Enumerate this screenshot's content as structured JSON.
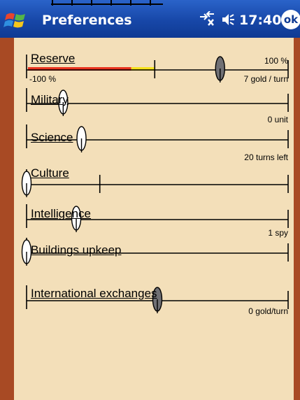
{
  "titlebar": {
    "title": "Preferences",
    "time": "17:40",
    "ok_label": "ok",
    "icons": [
      "windows-start-icon",
      "connectivity-icon",
      "volume-icon",
      "ok-icon"
    ]
  },
  "sliders": [
    {
      "label": "Reserve",
      "value_text": "100 %",
      "min_text": "-100 %",
      "secondary_text": "7 gold / turn",
      "knob_level": 0.74,
      "knob_style": "dark",
      "marker_level": 0.49,
      "bar_red_to": 0.4,
      "bar_yellow_to": 0.49
    },
    {
      "label": "Military",
      "value_text": "0 unit",
      "knob_level": 0.14,
      "knob_style": "white"
    },
    {
      "label": "Science",
      "value_text": "20 turns left",
      "knob_level": 0.21,
      "knob_style": "white"
    },
    {
      "label": "Culture",
      "value_text": "",
      "knob_level": 0.0,
      "knob_style": "white",
      "marker_level": 0.28
    },
    {
      "label": "Intelligence",
      "value_text": "1 spy",
      "knob_level": 0.19,
      "knob_style": "white"
    },
    {
      "label": "Buildings upkeep",
      "value_text": "",
      "knob_level": 0.0,
      "knob_style": "white"
    },
    {
      "label": "International exchanges",
      "value_text": "0 gold/turn",
      "knob_level": 0.5,
      "knob_style": "dark"
    }
  ],
  "colors": {
    "titlebar": "#1747a8",
    "frame": "#a84a24",
    "panel": "#f3dfb9",
    "bar_red": "#e8331f",
    "bar_yellow": "#f6e21c",
    "knob_dark": "#707074"
  }
}
